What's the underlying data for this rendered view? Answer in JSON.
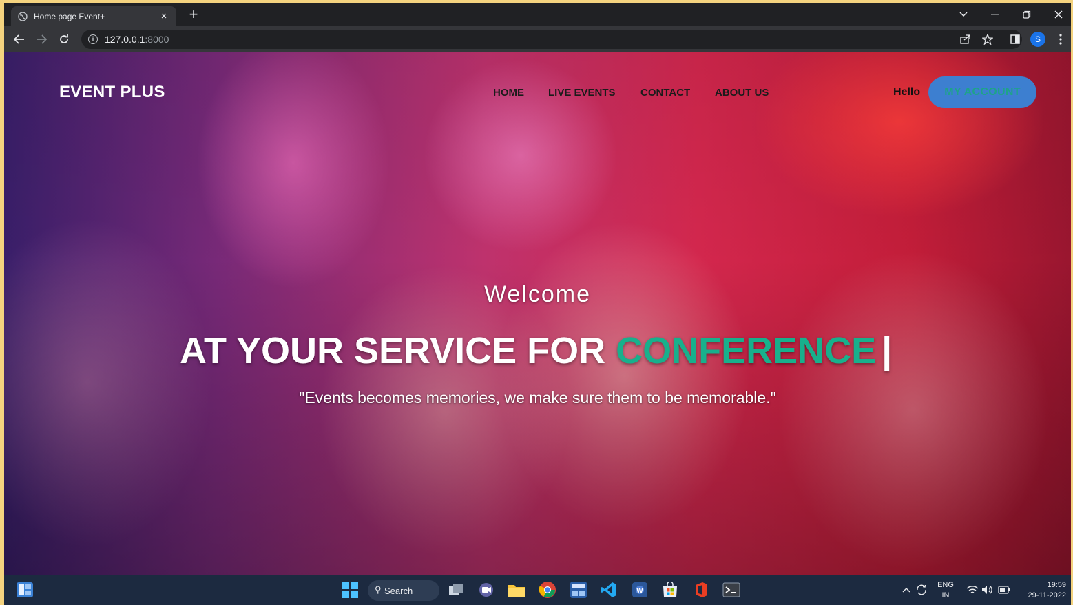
{
  "browser": {
    "tab_title": "Home page Event+",
    "tab_close": "×",
    "new_tab": "+",
    "url_host": "127.0.0.1",
    "url_port": ":8000",
    "profile_initial": "S"
  },
  "site": {
    "brand": "EVENT PLUS",
    "nav": [
      "HOME",
      "LIVE EVENTS",
      "CONTACT",
      "ABOUT US"
    ],
    "hello": "Hello",
    "account_button": "MY ACCOUNT"
  },
  "hero": {
    "welcome": "Welcome",
    "headline_prefix": "AT YOUR SERVICE FOR",
    "headline_accent": "CONFERENCE",
    "cursor": "|",
    "quote": "\"Events becomes memories, we make sure them to be memorable.\""
  },
  "taskbar": {
    "search_label": "Search",
    "lang": "ENG",
    "region": "IN",
    "time": "19:59",
    "date": "29-11-2022"
  },
  "colors": {
    "accent": "#18b08c",
    "account_button_bg": "#3d7fd0",
    "browser_bg": "#202124",
    "taskbar_bg": "#1c2a40"
  }
}
